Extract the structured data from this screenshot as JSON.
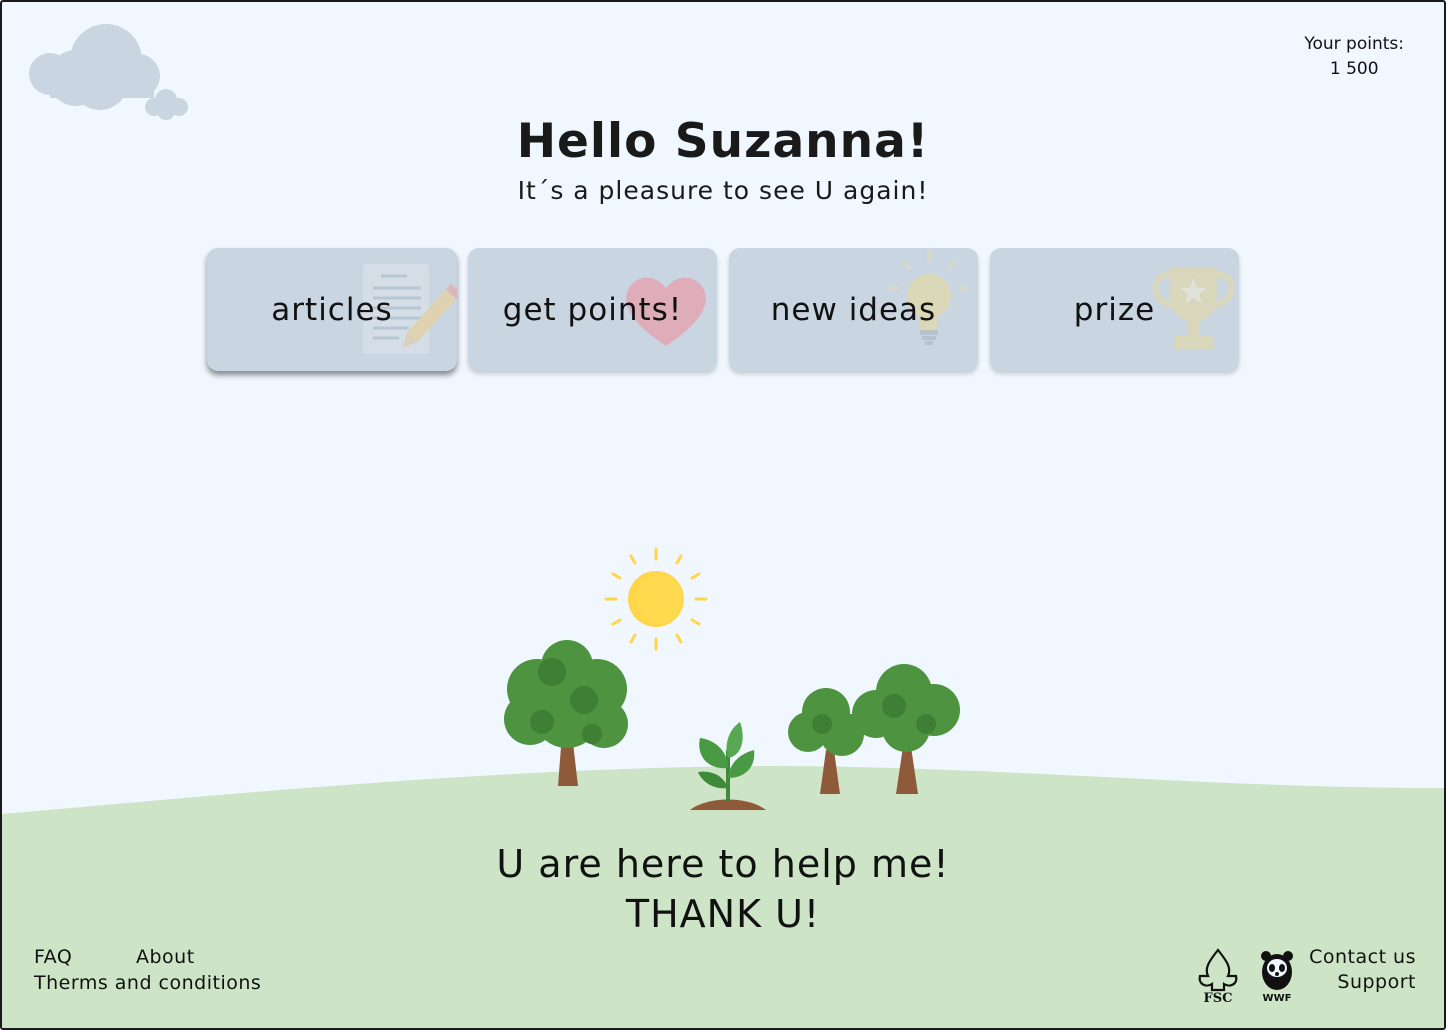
{
  "points": {
    "label": "Your points:",
    "value": "1 500"
  },
  "greeting": {
    "title": "Hello Suzanna!",
    "subtitle": "It´s a pleasure to see U again!"
  },
  "cards": [
    {
      "label": "articles",
      "icon": "document-pencil-icon"
    },
    {
      "label": "get points!",
      "icon": "heart-icon"
    },
    {
      "label": "new ideas",
      "icon": "lightbulb-icon"
    },
    {
      "label": "prize",
      "icon": "trophy-icon"
    }
  ],
  "message": {
    "line1": "U are here to help me!",
    "line2": "THANK U!"
  },
  "footer": {
    "left": {
      "faq": "FAQ",
      "about": "About",
      "terms": "Therms and conditions"
    },
    "right": {
      "contact": "Contact us",
      "support": "Support"
    },
    "logos": {
      "fsc": "FSC",
      "wwf": "WWF"
    }
  },
  "colors": {
    "background": "#f0f7fe",
    "card": "#c9d5e0",
    "grass": "#cde5c6",
    "sun": "#ffd54a"
  }
}
